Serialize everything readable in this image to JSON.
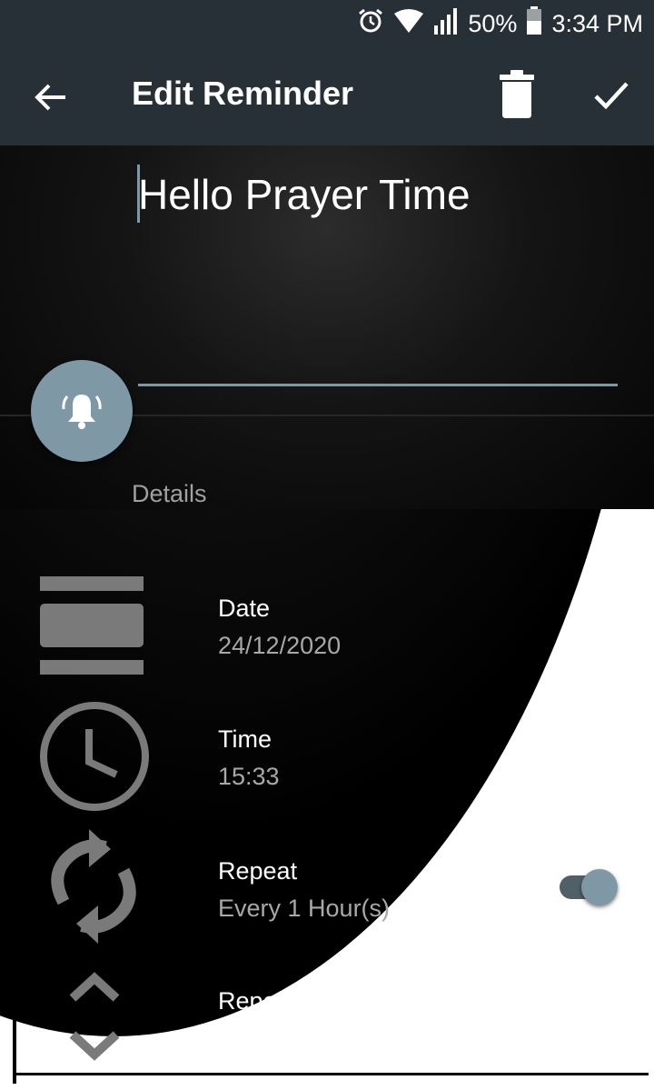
{
  "status_bar": {
    "battery": "50%",
    "time": "3:34 PM",
    "icons": [
      "alarm-icon",
      "wifi-icon",
      "signal-icon",
      "battery-icon"
    ]
  },
  "toolbar": {
    "title": "Edit Reminder",
    "back_icon": "arrow-back-icon",
    "delete_icon": "trash-icon",
    "done_icon": "checkmark-icon"
  },
  "reminder": {
    "title_value": "Hello Prayer Time",
    "bell_icon": "bell-ringing-icon"
  },
  "details": {
    "header": "Details",
    "rows": [
      {
        "label": "Date",
        "value": "24/12/2020",
        "icon": "calendar-icon"
      },
      {
        "label": "Time",
        "value": "15:33",
        "icon": "clock-icon"
      },
      {
        "label": "Repeat",
        "value": "Every 1 Hour(s)",
        "icon": "repeat-icon"
      },
      {
        "label": "Repetition Interval",
        "value": "",
        "icon": "up-down-chevron-icon"
      }
    ],
    "repeat_enabled": true
  },
  "colors": {
    "toolbar": "#263036",
    "accent": "#7f98a6"
  }
}
